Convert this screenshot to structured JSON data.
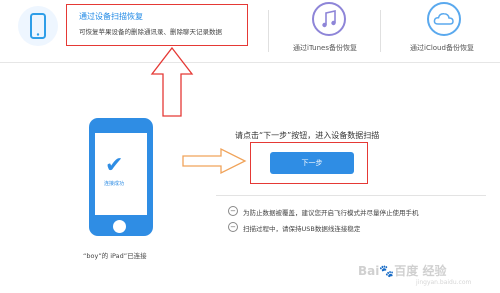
{
  "modes": {
    "device": {
      "title": "通过设备扫描恢复",
      "desc": "可恢复苹果设备的删除通讯录、删除聊天记录数据",
      "icon": "phone-icon"
    },
    "itunes": {
      "label": "通过iTunes备份恢复",
      "icon": "music-note-icon"
    },
    "icloud": {
      "label": "通过iCloud备份恢复",
      "icon": "cloud-icon"
    }
  },
  "device": {
    "status_text": "连接成功",
    "label": "“boy”的 iPad”已连接"
  },
  "main": {
    "instruction": "请点击“下一步”按钮，进入设备数据扫描",
    "next_label": "下一步"
  },
  "notes": [
    {
      "icon": "minus-circle-icon",
      "text": "为防止数据被覆盖，建议您开启飞行模式并尽量停止使用手机"
    },
    {
      "icon": "minus-circle-icon",
      "text": "扫描过程中，请保持USB数据线连接稳定"
    }
  ],
  "watermark": {
    "text": "Bai🐾百度 经验",
    "sub": "jingyan.baidu.com"
  },
  "colors": {
    "accent": "#2f8de4",
    "annotation": "#e53935"
  }
}
